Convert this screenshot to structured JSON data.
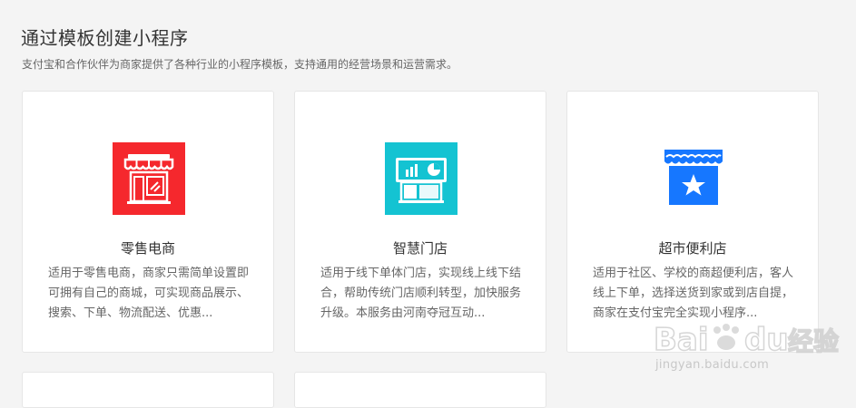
{
  "header": {
    "title": "通过模板创建小程序",
    "subtitle": "支付宝和合作伙伴为商家提供了各种行业的小程序模板，支持通用的经营场景和运营需求。"
  },
  "cards": [
    {
      "title": "零售电商",
      "desc": "适用于零售电商，商家只需简单设置即可拥有自己的商城，可实现商品展示、搜索、下单、物流配送、优惠...",
      "icon": "storefront-icon",
      "icon_bg": "#f5282d"
    },
    {
      "title": "智慧门店",
      "desc": "适用于线下单体门店，实现线上线下结合，帮助传统门店顺利转型，加快服务升级。本服务由河南夺冠互动...",
      "icon": "smart-store-chart-icon",
      "icon_bg": "#14c3d2"
    },
    {
      "title": "超市便利店",
      "desc": "适用于社区、学校的商超便利店，客人线上下单，选择送货到家或到店自提，商家在支付宝完全实现小程序...",
      "icon": "star-shop-icon",
      "icon_bg": "#1677ff"
    }
  ],
  "watermark": {
    "logo_text": "Baidu经验",
    "url": "jingyan.baidu.com"
  }
}
